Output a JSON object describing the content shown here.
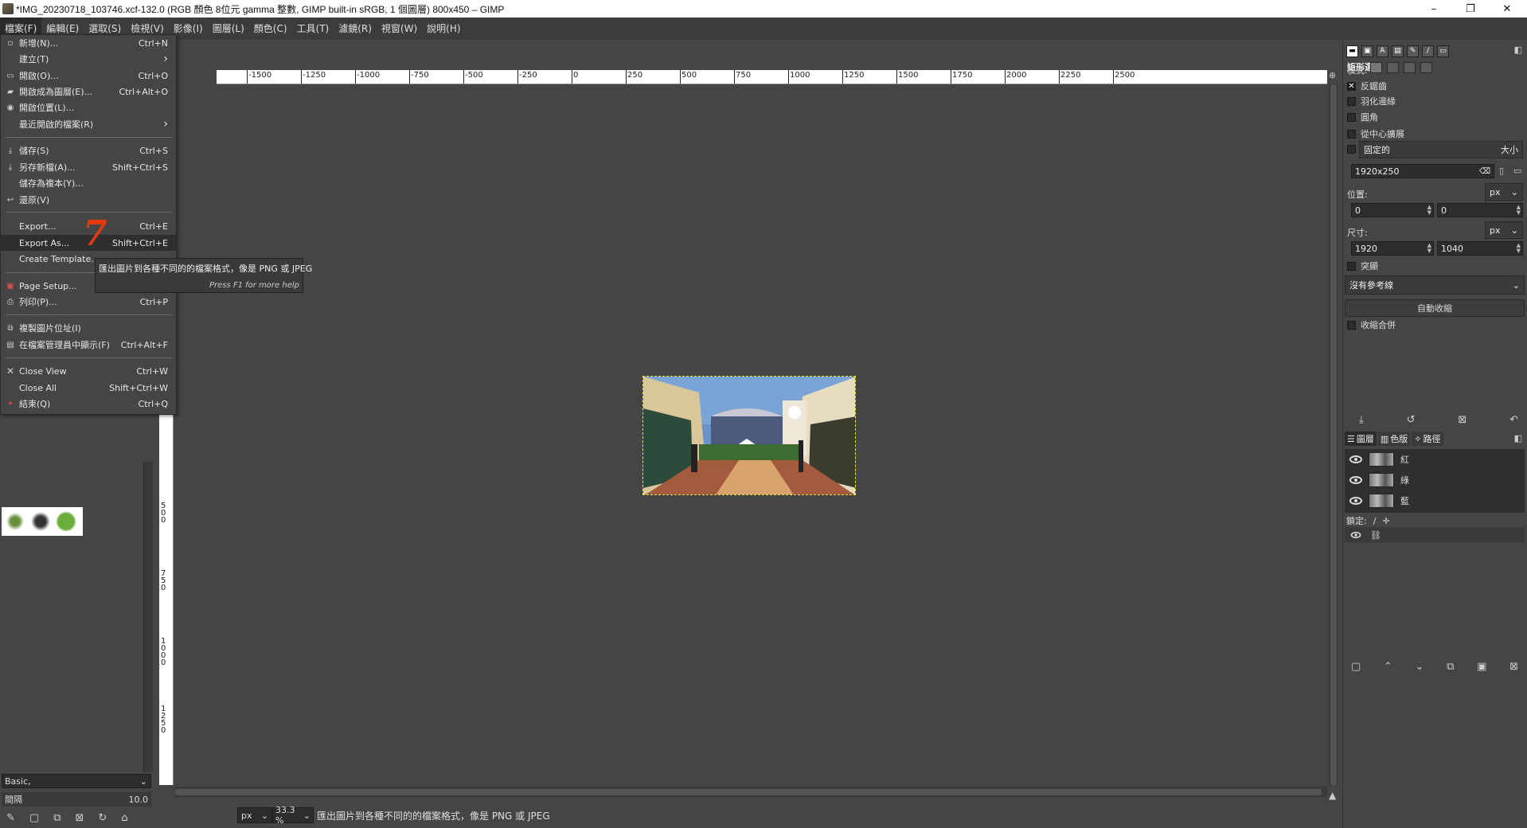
{
  "window": {
    "title": "*IMG_20230718_103746.xcf-132.0 (RGB 顏色 8位元 gamma 整數, GIMP built-in sRGB, 1 個圖層) 800x450 – GIMP",
    "minimize": "–",
    "maximize": "❐",
    "close": "✕"
  },
  "menubar": [
    "檔案(F)",
    "編輯(E)",
    "選取(S)",
    "檢視(V)",
    "影像(I)",
    "圖層(L)",
    "顏色(C)",
    "工具(T)",
    "濾鏡(R)",
    "視窗(W)",
    "說明(H)"
  ],
  "file_menu": {
    "items": [
      {
        "label": "新增(N)...",
        "accel": "Ctrl+N",
        "icon": "new-file-icon"
      },
      {
        "label": "建立(T)",
        "accel": "›",
        "icon": ""
      },
      {
        "label": "開啟(O)...",
        "accel": "Ctrl+O",
        "icon": "open-icon"
      },
      {
        "label": "開啟成為圖層(E)...",
        "accel": "Ctrl+Alt+O",
        "icon": "open-as-layers-icon"
      },
      {
        "label": "開啟位置(L)...",
        "accel": "",
        "icon": "location-icon"
      },
      {
        "label": "最近開啟的檔案(R)",
        "accel": "›",
        "icon": ""
      },
      {
        "label": "儲存(S)",
        "accel": "Ctrl+S",
        "icon": "save-icon"
      },
      {
        "label": "另存新檔(A)...",
        "accel": "Shift+Ctrl+S",
        "icon": "save-as-icon"
      },
      {
        "label": "儲存為複本(Y)...",
        "accel": "",
        "icon": ""
      },
      {
        "label": "還原(V)",
        "accel": "",
        "icon": "revert-icon"
      },
      {
        "label": "Export...",
        "accel": "Ctrl+E",
        "icon": ""
      },
      {
        "label": "Export As...",
        "accel": "Shift+Ctrl+E",
        "icon": ""
      },
      {
        "label": "Create Template...",
        "accel": "",
        "icon": ""
      },
      {
        "label": "Page Setup...",
        "accel": "",
        "icon": "page-setup-icon"
      },
      {
        "label": "列印(P)...",
        "accel": "Ctrl+P",
        "icon": "print-icon"
      },
      {
        "label": "複製圖片位址(I)",
        "accel": "",
        "icon": "copy-location-icon"
      },
      {
        "label": "在檔案管理員中顯示(F)",
        "accel": "Ctrl+Alt+F",
        "icon": "file-manager-icon"
      },
      {
        "label": "Close View",
        "accel": "Ctrl+W",
        "icon": "close-view-icon"
      },
      {
        "label": "Close All",
        "accel": "Shift+Ctrl+W",
        "icon": ""
      },
      {
        "label": "結束(Q)",
        "accel": "Ctrl+Q",
        "icon": "quit-icon"
      }
    ],
    "annotation": "7"
  },
  "tooltip": {
    "text": "匯出圖片到各種不同的的檔案格式，像是 PNG 或 JPEG",
    "help": "Press F1 for more help"
  },
  "ruler_top_labels": [
    "-1500",
    "-1250",
    "-1000",
    "-750",
    "-500",
    "-250",
    "0",
    "250",
    "500",
    "750",
    "1000",
    "1250",
    "1500",
    "1750",
    "2000",
    "2250",
    "2500"
  ],
  "ruler_left_labels": [
    "500",
    "750",
    "1000",
    "1250"
  ],
  "left_dock": {
    "preset": "Basic,",
    "spacing_label": "間隔",
    "spacing_value": "10.0"
  },
  "status": {
    "unit": "px",
    "zoom": "33.3 %",
    "message": "匯出圖片到各種不同的的檔案格式，像是 PNG 或 JPEG"
  },
  "tool_options": {
    "title": "矩形選取",
    "mode_label": "模式:",
    "antialias": "反鋸齒",
    "feather": "羽化邊緣",
    "rounded": "圓角",
    "expand_center": "從中心擴展",
    "fixed": "固定的",
    "fixed_mode": "大小",
    "fixed_value": "1920x250",
    "position_label": "位置:",
    "position_unit": "px",
    "pos_x": "0",
    "pos_y": "0",
    "size_label": "尺寸:",
    "size_unit": "px",
    "size_w": "1920",
    "size_h": "1040",
    "highlight": "突顯",
    "guides": "沒有參考線",
    "auto_shrink": "自動收縮",
    "shrink_merged": "收縮合併"
  },
  "layers_panel": {
    "tabs": [
      "圖層",
      "色版",
      "路徑"
    ],
    "channels": [
      {
        "name": "紅"
      },
      {
        "name": "綠"
      },
      {
        "name": "藍"
      }
    ],
    "lock_label": "鎖定:"
  }
}
